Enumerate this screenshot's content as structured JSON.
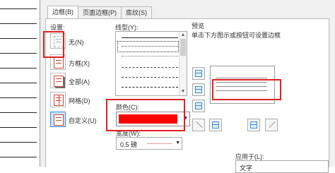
{
  "tabs": [
    {
      "label": "边框(B)",
      "active": true
    },
    {
      "label": "页面边框(P)",
      "active": false
    },
    {
      "label": "底纹(S)",
      "active": false
    }
  ],
  "settings": {
    "title": "设置:",
    "items": [
      {
        "label": "无(N)",
        "icon": "setting-none-icon"
      },
      {
        "label": "方框(X)",
        "icon": "setting-box-icon"
      },
      {
        "label": "全部(A)",
        "icon": "setting-all-icon"
      },
      {
        "label": "网格(D)",
        "icon": "setting-grid-icon"
      },
      {
        "label": "自定义(U)",
        "icon": "setting-custom-icon"
      }
    ]
  },
  "line_style": {
    "title": "线型(Y):"
  },
  "color": {
    "title": "颜色(C):",
    "value": "#ff0000"
  },
  "width": {
    "title": "宽度(W):",
    "value": "0.5 磅"
  },
  "preview": {
    "title": "预览",
    "hint": "单击下方图示或按钮可设置边框"
  },
  "apply_to": {
    "title": "应用于(L):",
    "value": "文字"
  },
  "highlight_color": "#e02020"
}
